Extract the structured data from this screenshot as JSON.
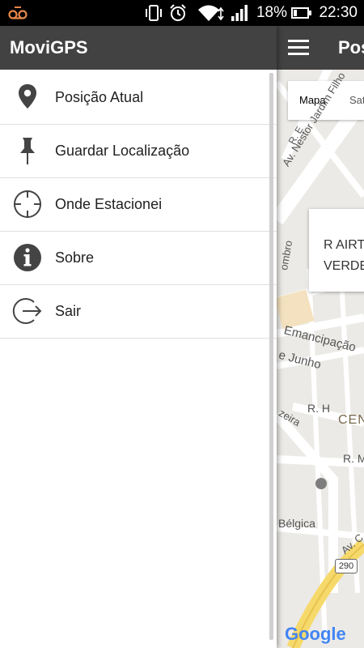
{
  "status_bar": {
    "battery_percent": "18%",
    "time": "22:30",
    "icons": [
      "voicemail-icon",
      "vibrate-icon",
      "alarm-icon",
      "wifi-icon",
      "signal-icon",
      "battery-icon"
    ]
  },
  "app": {
    "title": "MoviGPS"
  },
  "menu": {
    "items": [
      {
        "label": "Posição Atual",
        "icon": "location-pin-icon"
      },
      {
        "label": "Guardar Localização",
        "icon": "push-pin-icon"
      },
      {
        "label": "Onde Estacionei",
        "icon": "crosshair-icon"
      },
      {
        "label": "Sobre",
        "icon": "info-icon"
      },
      {
        "label": "Sair",
        "icon": "exit-icon"
      }
    ]
  },
  "map": {
    "header_title": "Pos",
    "tabs": [
      "Mapa",
      "Sat"
    ],
    "info_box": {
      "line1": "R AIRTO",
      "line2": "VERDE"
    },
    "street_labels": [
      "R. Nestor Jardim Filho",
      "Av. Nestor Jardim Filho",
      "R. E",
      "Emancipação",
      "e Junho",
      "R. H",
      "CEN",
      "R. M",
      "Bélgica",
      "Av. C",
      "zeira",
      "ombro"
    ],
    "road_badge": "290",
    "logo": "Google"
  },
  "colors": {
    "header": "#424242",
    "map_bg": "#eceae6",
    "icon": "#444444"
  }
}
